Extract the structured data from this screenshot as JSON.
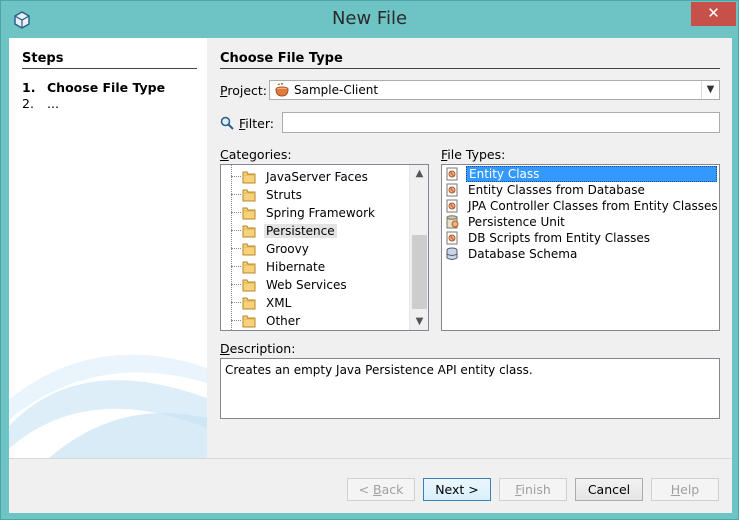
{
  "window": {
    "title": "New File",
    "close_glyph": "✕"
  },
  "steps": {
    "title": "Steps",
    "items": [
      {
        "num": "1.",
        "label": "Choose File Type"
      },
      {
        "num": "2.",
        "label": "..."
      }
    ]
  },
  "main": {
    "title": "Choose File Type",
    "project": {
      "label_key": "P",
      "label_rest": "roject:",
      "value": "Sample-Client",
      "icon": "coffee-cup-icon"
    },
    "filter": {
      "label_key": "F",
      "label_rest": "ilter:",
      "value": "",
      "icon": "magnifier-icon"
    },
    "categories": {
      "label_key": "C",
      "label_rest": "ategories:",
      "items": [
        "JavaServer Faces",
        "Struts",
        "Spring Framework",
        "Persistence",
        "Groovy",
        "Hibernate",
        "Web Services",
        "XML",
        "Other"
      ],
      "selected": "Persistence"
    },
    "file_types": {
      "label_key": "F",
      "label_rest": "ile Types:",
      "items": [
        "Entity Class",
        "Entity Classes from Database",
        "JPA Controller Classes from Entity Classes",
        "Persistence Unit",
        "DB Scripts from Entity Classes",
        "Database Schema"
      ],
      "selected": "Entity Class"
    },
    "description": {
      "label_key": "D",
      "label_rest": "escription:",
      "text": "Creates an empty Java Persistence API entity class."
    }
  },
  "buttons": {
    "back": {
      "prefix": "< ",
      "key": "B",
      "rest": "ack"
    },
    "next": "Next >",
    "finish": {
      "key": "F",
      "rest": "inish"
    },
    "cancel": "Cancel",
    "help": {
      "key": "H",
      "rest": "elp"
    }
  },
  "colors": {
    "title_bar": "#6ec3c4",
    "close": "#c7504a",
    "selection": "#3399ff"
  }
}
